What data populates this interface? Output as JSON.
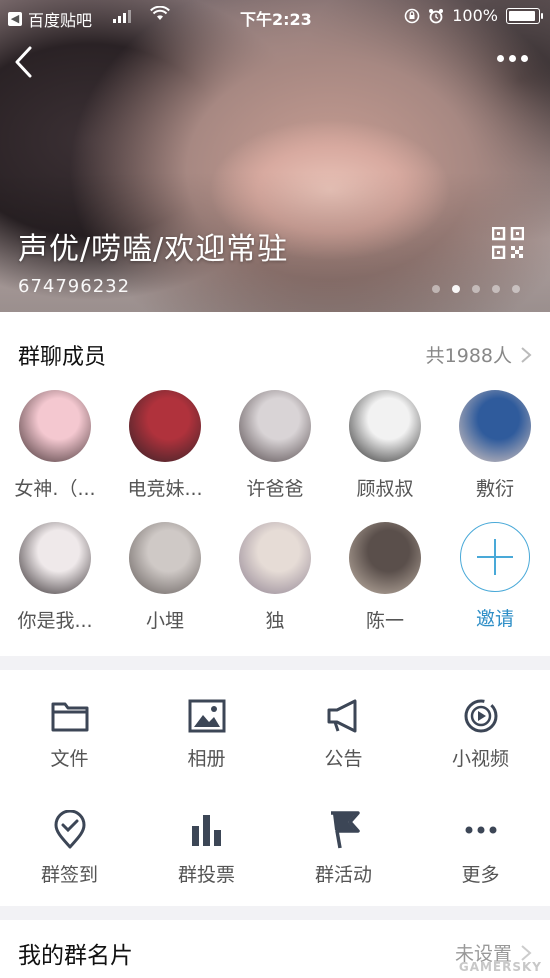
{
  "status_bar": {
    "back_app": "百度贴吧",
    "time": "下午2:23",
    "battery": "100%"
  },
  "header": {
    "group_name": "声优/唠嗑/欢迎常驻",
    "group_id": "674796232",
    "carousel_pages": 5,
    "carousel_active_index": 1
  },
  "members": {
    "title": "群聊成员",
    "count_label": "共1988人",
    "list": [
      {
        "name": "女神.（...",
        "colors": [
          "#f4c8d0",
          "#3a2a2c"
        ]
      },
      {
        "name": "电竞妹...",
        "colors": [
          "#b0323c",
          "#2c2126"
        ]
      },
      {
        "name": "许爸爸",
        "colors": [
          "#d9d4d6",
          "#4a3f42"
        ]
      },
      {
        "name": "顾叔叔",
        "colors": [
          "#f2f2f2",
          "#222222"
        ]
      },
      {
        "name": "敷衍",
        "colors": [
          "#2f5b9c",
          "#e9d2c4"
        ]
      },
      {
        "name": "你是我...",
        "colors": [
          "#efe9ea",
          "#2a2326"
        ]
      },
      {
        "name": "小埋",
        "colors": [
          "#cfc9c6",
          "#5d5654"
        ]
      },
      {
        "name": "独",
        "colors": [
          "#e6dcd6",
          "#8a7d8e"
        ]
      },
      {
        "name": "陈一",
        "colors": [
          "#5a4f4b",
          "#c7b9ac"
        ]
      }
    ],
    "invite_label": "邀请"
  },
  "tools": [
    {
      "label": "文件",
      "icon": "folder-icon"
    },
    {
      "label": "相册",
      "icon": "album-icon"
    },
    {
      "label": "公告",
      "icon": "megaphone-icon"
    },
    {
      "label": "小视频",
      "icon": "video-icon"
    },
    {
      "label": "群签到",
      "icon": "checkin-icon"
    },
    {
      "label": "群投票",
      "icon": "vote-icon"
    },
    {
      "label": "群活动",
      "icon": "flag-icon"
    },
    {
      "label": "更多",
      "icon": "more-icon"
    }
  ],
  "card": {
    "title": "我的群名片",
    "value": "未设置"
  },
  "watermark": "GAMERSKY",
  "colors": {
    "accent": "#2f8fc7",
    "icon": "#3c4656",
    "text_secondary": "#555555"
  }
}
